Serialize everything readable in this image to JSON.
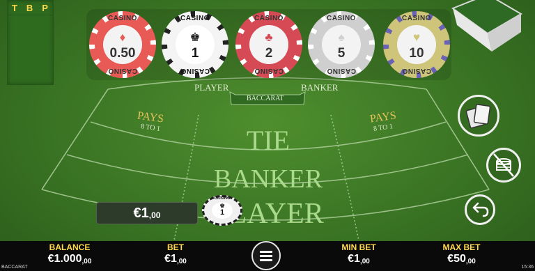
{
  "scorecard": {
    "headers": [
      "T",
      "B",
      "P"
    ]
  },
  "chips": [
    {
      "value": "0.50",
      "suit": "♦",
      "brand": "CASINO",
      "colors": {
        "main": "#e85a55",
        "inner": "#f3f3f3",
        "text": "#333333",
        "stripe": "#ffffff"
      }
    },
    {
      "value": "1",
      "suit": "♚",
      "brand": "CASINO",
      "colors": {
        "main": "#f4f4f4",
        "inner": "#ffffff",
        "text": "#111111",
        "stripe": "#222222"
      }
    },
    {
      "value": "2",
      "suit": "♣",
      "brand": "CASINO",
      "colors": {
        "main": "#d54a55",
        "inner": "#f3f3f3",
        "text": "#333333",
        "stripe": "#ffffff"
      }
    },
    {
      "value": "5",
      "suit": "♠",
      "brand": "CASINO",
      "colors": {
        "main": "#cfcfcf",
        "inner": "#f3f3f3",
        "text": "#333333",
        "stripe": "#ffffff"
      }
    },
    {
      "value": "10",
      "suit": "♥",
      "brand": "CASINO",
      "colors": {
        "main": "#cfc57a",
        "inner": "#f3f3f3",
        "text": "#333333",
        "stripe": "#6a62b5"
      }
    }
  ],
  "table": {
    "player_label": "PLAYER",
    "banker_label": "BANKER",
    "game_badge": "BACCARAT",
    "left_pays": "PAYS",
    "left_odds": "8 TO 1",
    "right_pays": "PAYS",
    "right_odds": "8 TO 1",
    "tie": "TIE",
    "banker": "BANKER",
    "player": "PLAYER"
  },
  "placed_bet": {
    "amount": "€1",
    "cents": ",00",
    "chip_value": "1",
    "chip_brand": "CASINO"
  },
  "bottom_bar": {
    "balance_title": "BALANCE",
    "balance_value": "€1.000",
    "balance_cents": ",00",
    "bet_title": "BET",
    "bet_value": "€1",
    "bet_cents": ",00",
    "min_title": "MIN BET",
    "min_value": "€1",
    "min_cents": ",00",
    "max_title": "MAX BET",
    "max_value": "€50",
    "max_cents": ",00"
  },
  "footer": {
    "game_name": "BACCARAT",
    "clock": "15:36"
  },
  "icons": [
    "cards-icon",
    "no-chips-icon",
    "undo-icon",
    "menu-icon",
    "card-shoe-icon"
  ],
  "colors": {
    "felt": "#3a7424",
    "gold": "#ffd84d",
    "pays_gold": "#e6c35a",
    "line": "#9fc48b"
  }
}
